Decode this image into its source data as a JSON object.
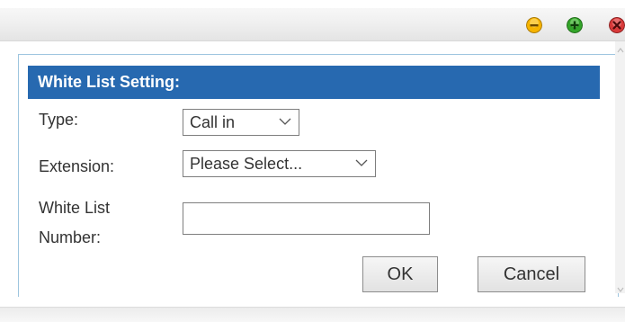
{
  "window": {
    "controls": [
      {
        "name": "minimize",
        "icon": "minus-circle-icon",
        "color": "#f6b400"
      },
      {
        "name": "maximize",
        "icon": "plus-circle-icon",
        "color": "#34a52a"
      },
      {
        "name": "close",
        "icon": "close-circle-icon",
        "color": "#d93a3a"
      }
    ]
  },
  "dialog": {
    "header": "White List Setting:",
    "header_color": "#2769b0",
    "fields": {
      "type": {
        "label": "Type:",
        "value": "Call in"
      },
      "extension": {
        "label": "Extension:",
        "value": "Please Select..."
      },
      "white_list_number": {
        "label_line1": "White List",
        "label_line2": "Number:",
        "value": ""
      }
    },
    "buttons": {
      "ok": "OK",
      "cancel": "Cancel"
    }
  }
}
